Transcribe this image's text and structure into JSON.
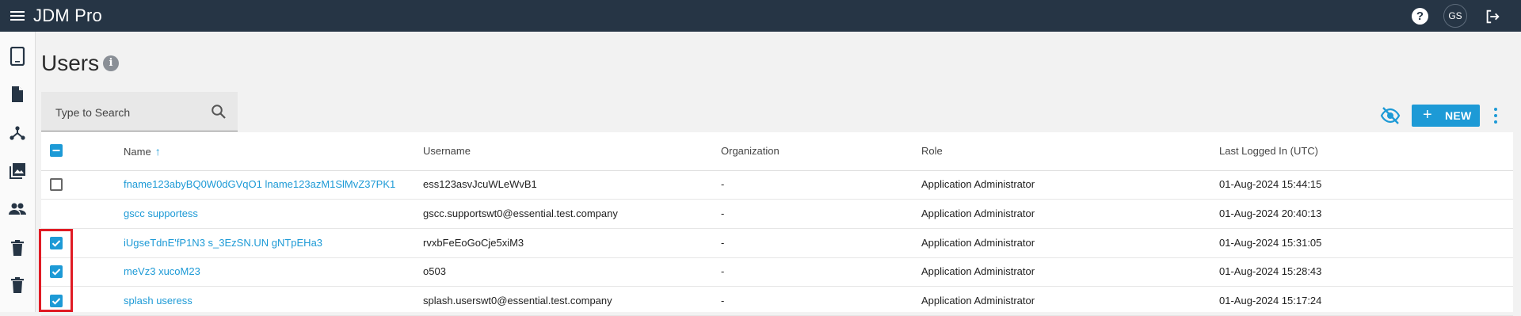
{
  "topbar": {
    "app_title": "JDM Pro",
    "help_label": "?",
    "avatar_initials": "GS"
  },
  "sidebar": {
    "items": [
      {
        "icon": "tablet-icon"
      },
      {
        "icon": "document-icon"
      },
      {
        "icon": "hub-icon"
      },
      {
        "icon": "gallery-icon"
      },
      {
        "icon": "people-icon"
      },
      {
        "icon": "trash-icon"
      },
      {
        "icon": "trash-icon"
      }
    ]
  },
  "page": {
    "title": "Users",
    "info_label": "i"
  },
  "search": {
    "placeholder": "Type to Search"
  },
  "toolbar": {
    "new_label": "NEW",
    "new_plus": "+"
  },
  "table": {
    "headers": {
      "name": "Name",
      "username": "Username",
      "organization": "Organization",
      "role": "Role",
      "last_logged_in": "Last Logged In (UTC)"
    },
    "sort_indicator": "↑",
    "rows": [
      {
        "checkbox": "unchecked",
        "name": "fname123abyBQ0W0dGVqO1 lname123azM1SlMvZ37PK1",
        "username": "ess123asvJcuWLeWvB1",
        "organization": "-",
        "role": "Application Administrator",
        "last_logged_in": "01-Aug-2024 15:44:15"
      },
      {
        "checkbox": "none",
        "name": "gscc supportess",
        "username": "gscc.supportswt0@essential.test.company",
        "organization": "-",
        "role": "Application Administrator",
        "last_logged_in": "01-Aug-2024 20:40:13"
      },
      {
        "checkbox": "checked",
        "name": "iUgseTdnE'fP1N3 s_3EzSN.UN gNTpEHa3",
        "username": "rvxbFeEoGoCje5xiM3",
        "organization": "-",
        "role": "Application Administrator",
        "last_logged_in": "01-Aug-2024 15:31:05"
      },
      {
        "checkbox": "checked",
        "name": "meVz3 xucoM23",
        "username": "o503",
        "organization": "-",
        "role": "Application Administrator",
        "last_logged_in": "01-Aug-2024 15:28:43"
      },
      {
        "checkbox": "checked",
        "name": "splash useress",
        "username": "splash.userswt0@essential.test.company",
        "organization": "-",
        "role": "Application Administrator",
        "last_logged_in": "01-Aug-2024 15:17:24"
      }
    ]
  },
  "colors": {
    "topbar_bg": "#263545",
    "accent": "#1d9ad6",
    "highlight": "#e01b24"
  }
}
